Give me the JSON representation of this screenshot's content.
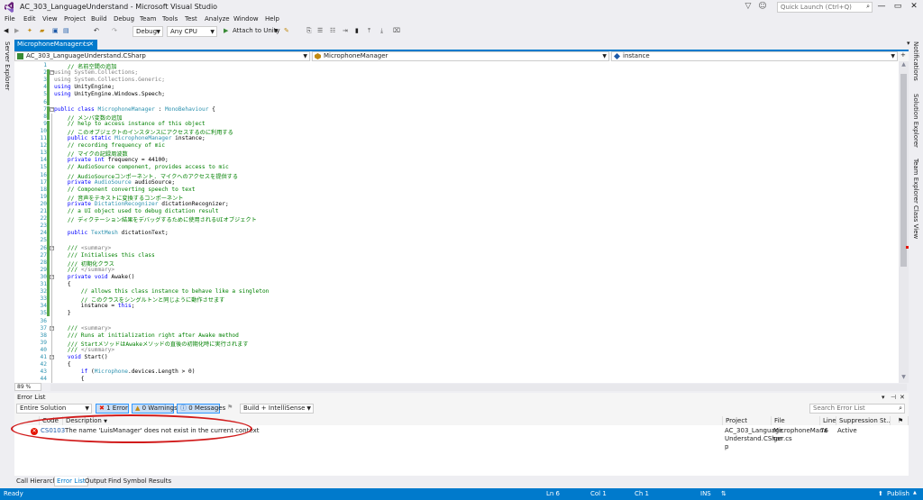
{
  "app": {
    "title": "AC_303_LanguageUnderstand - Microsoft Visual Studio",
    "quick_launch_placeholder": "Quick Launch (Ctrl+Q)"
  },
  "menu": [
    "File",
    "Edit",
    "View",
    "Project",
    "Build",
    "Debug",
    "Team",
    "Tools",
    "Test",
    "Analyze",
    "Window",
    "Help"
  ],
  "toolbar": {
    "config": "Debug",
    "platform": "Any CPU",
    "run_label": "Attach to Unity"
  },
  "left_strip": {
    "label": "Server Explorer"
  },
  "right_strip": {
    "items": [
      "Notifications",
      "Solution Explorer",
      "Team Explorer",
      "Class View"
    ]
  },
  "doc_tab": {
    "label": "MicrophoneManager.cs"
  },
  "navbar": {
    "project": "AC_303_LanguageUnderstand.CSharp",
    "type": "MicrophoneManager",
    "member": "instance"
  },
  "editor": {
    "zoom": "89 %",
    "lines": [
      {
        "n": "1",
        "t": "    // 名前空間の追加",
        "c": "cm"
      },
      {
        "n": "2",
        "t": "using System.Collections;",
        "c": "gr"
      },
      {
        "n": "3",
        "t": "using System.Collections.Generic;",
        "c": "gr"
      },
      {
        "n": "4",
        "t": "using UnityEngine;",
        "c": "us"
      },
      {
        "n": "5",
        "t": "using UnityEngine.Windows.Speech;",
        "c": "us"
      },
      {
        "n": "6",
        "t": "",
        "c": ""
      },
      {
        "n": "7",
        "t": "public class MicrophoneManager : MonoBehaviour {",
        "c": "cls"
      },
      {
        "n": "8",
        "t": "    // メンバ変数の追加",
        "c": "cm"
      },
      {
        "n": "9",
        "t": "    // help to access instance of this object",
        "c": "cm"
      },
      {
        "n": "10",
        "t": "    // このオブジェクトのインスタンスにアクセスするのに利用する",
        "c": "cm"
      },
      {
        "n": "11",
        "t": "    public static MicrophoneManager instance;",
        "c": "ps"
      },
      {
        "n": "12",
        "t": "    // recording frequency of mic",
        "c": "cm"
      },
      {
        "n": "13",
        "t": "    // マイクの記録周波数",
        "c": "cm"
      },
      {
        "n": "14",
        "t": "    private int frequency = 44100;",
        "c": "pi"
      },
      {
        "n": "15",
        "t": "    // AudioSource component, provides access to mic",
        "c": "cm"
      },
      {
        "n": "16",
        "t": "    // AudioSourceコンポーネント. マイクへのアクセスを提供する",
        "c": "cm"
      },
      {
        "n": "17",
        "t": "    private AudioSource audioSource;",
        "c": "pt"
      },
      {
        "n": "18",
        "t": "    // Component converting speech to text",
        "c": "cm"
      },
      {
        "n": "19",
        "t": "    // 音声をテキストに変換するコンポーネント",
        "c": "cm"
      },
      {
        "n": "20",
        "t": "    private DictationRecognizer dictationRecognizer;",
        "c": "pt"
      },
      {
        "n": "21",
        "t": "    // a UI object used to debug dictation result",
        "c": "cm"
      },
      {
        "n": "22",
        "t": "    // ディクテーション結果をデバッグするために使用されるUIオブジェクト",
        "c": "cm"
      },
      {
        "n": "23",
        "t": "",
        "c": ""
      },
      {
        "n": "24",
        "t": "    public TextMesh dictationText;",
        "c": "pt"
      },
      {
        "n": "25",
        "t": "",
        "c": ""
      },
      {
        "n": "26",
        "t": "    /// <summary>",
        "c": "doc"
      },
      {
        "n": "27",
        "t": "    /// Initialises this class",
        "c": "cm"
      },
      {
        "n": "28",
        "t": "    /// 初期化クラス",
        "c": "cm"
      },
      {
        "n": "29",
        "t": "    /// </summary>",
        "c": "doc"
      },
      {
        "n": "30",
        "t": "    private void Awake()",
        "c": "pv"
      },
      {
        "n": "31",
        "t": "    {",
        "c": ""
      },
      {
        "n": "32",
        "t": "        // allows this class instance to behave like a singleton",
        "c": "cm"
      },
      {
        "n": "33",
        "t": "        // このクラスをシングルトンと同じように動作させます",
        "c": "cm"
      },
      {
        "n": "34",
        "t": "        instance = this;",
        "c": "th"
      },
      {
        "n": "35",
        "t": "    }",
        "c": ""
      },
      {
        "n": "36",
        "t": "",
        "c": ""
      },
      {
        "n": "37",
        "t": "    /// <summary>",
        "c": "doc"
      },
      {
        "n": "38",
        "t": "    /// Runs at initialization right after Awake method",
        "c": "cm"
      },
      {
        "n": "39",
        "t": "    /// StartメソッドはAwakeメソッドの直後の初期化時に実行されます",
        "c": "cm"
      },
      {
        "n": "40",
        "t": "    /// </summary>",
        "c": "doc"
      },
      {
        "n": "41",
        "t": "    void Start()",
        "c": "vd"
      },
      {
        "n": "42",
        "t": "    {",
        "c": ""
      },
      {
        "n": "43",
        "t": "        if (Microphone.devices.Length > 0)",
        "c": "if"
      },
      {
        "n": "44",
        "t": "        {",
        "c": ""
      }
    ]
  },
  "error_list": {
    "title": "Error List",
    "scope": "Entire Solution",
    "errors_btn": "1 Error",
    "warnings_btn": "0 Warnings",
    "messages_btn": "0 Messages",
    "build_filter": "Build + IntelliSense",
    "search_placeholder": "Search Error List",
    "columns": [
      "Code",
      "Description",
      "Project",
      "File",
      "Line",
      "Suppression St..."
    ],
    "rows": [
      {
        "code": "CS0103",
        "description": "The name 'LuisManager' does not exist in the current context",
        "project": [
          "AC_303_Language",
          "Understand.CShar",
          "p"
        ],
        "file": [
          "MicrophoneMana",
          "ger.cs"
        ],
        "line": "76",
        "suppression": "Active"
      }
    ]
  },
  "bottom_tabs": [
    "Call Hierarchy",
    "Error List",
    "Output",
    "Find Symbol Results"
  ],
  "status": {
    "state": "Ready",
    "ln": "Ln 6",
    "col": "Col 1",
    "ch": "Ch 1",
    "ins": "INS",
    "publish": "Publish"
  },
  "colors": {
    "accent": "#007acc",
    "error": "#e51400",
    "annotation": "#d11b1b"
  }
}
